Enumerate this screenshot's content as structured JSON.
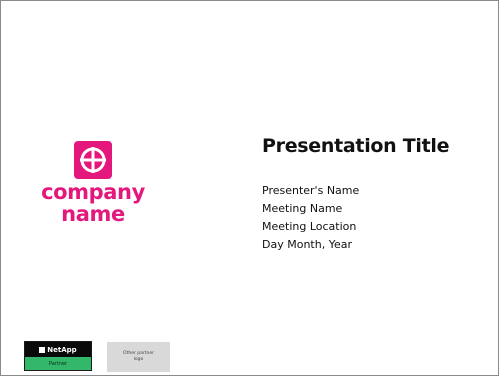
{
  "company": {
    "name": "company\nname",
    "brand_color": "#e4177d",
    "logo_icon": "crosshair-icon"
  },
  "title": "Presentation Title",
  "details": [
    "Presenter's Name",
    "Meeting Name",
    "Meeting Location",
    "Day Month, Year"
  ],
  "footer": {
    "netapp_badge": {
      "brand": "NetApp",
      "tier": "Partner",
      "top_color": "#0a0a0a",
      "bottom_color": "#33b86b"
    },
    "other_partner_logo": "Other partner\nlogo"
  }
}
